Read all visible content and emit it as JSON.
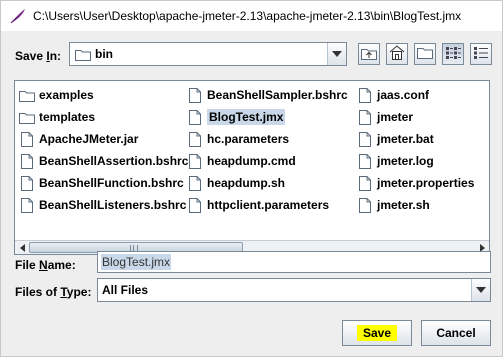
{
  "window": {
    "title": "C:\\Users\\User\\Desktop\\apache-jmeter-2.13\\apache-jmeter-2.13\\bin\\BlogTest.jmx",
    "app_icon": "feather-icon"
  },
  "save_in": {
    "label": "Save In:",
    "mnemonic_note": "I",
    "current_folder": "bin",
    "folder_icon": "folder-icon"
  },
  "toolbar": {
    "buttons": [
      {
        "name": "up-one-level",
        "icon": "folder-up-icon"
      },
      {
        "name": "home",
        "icon": "home-icon"
      },
      {
        "name": "new-folder",
        "icon": "new-folder-icon"
      },
      {
        "name": "list-view",
        "icon": "list-view-icon",
        "pressed": true
      },
      {
        "name": "details-view",
        "icon": "details-view-icon"
      }
    ]
  },
  "files": {
    "column1": [
      {
        "name": "examples",
        "type": "folder"
      },
      {
        "name": "templates",
        "type": "folder"
      },
      {
        "name": "ApacheJMeter.jar",
        "type": "file"
      },
      {
        "name": "BeanShellAssertion.bshrc",
        "type": "file"
      },
      {
        "name": "BeanShellFunction.bshrc",
        "type": "file"
      },
      {
        "name": "BeanShellListeners.bshrc",
        "type": "file"
      }
    ],
    "column2": [
      {
        "name": "BeanShellSampler.bshrc",
        "type": "file"
      },
      {
        "name": "BlogTest.jmx",
        "type": "file",
        "selected": true
      },
      {
        "name": "hc.parameters",
        "type": "file"
      },
      {
        "name": "heapdump.cmd",
        "type": "file"
      },
      {
        "name": "heapdump.sh",
        "type": "file"
      },
      {
        "name": "httpclient.parameters",
        "type": "file"
      }
    ],
    "column3": [
      {
        "name": "jaas.conf",
        "type": "file"
      },
      {
        "name": "jmeter",
        "type": "file"
      },
      {
        "name": "jmeter.bat",
        "type": "file"
      },
      {
        "name": "jmeter.log",
        "type": "file"
      },
      {
        "name": "jmeter.properties",
        "type": "file"
      },
      {
        "name": "jmeter.sh",
        "type": "file"
      }
    ]
  },
  "file_name": {
    "label": "File Name:",
    "value": "BlogTest.jmx"
  },
  "files_of_type": {
    "label": "Files of Type:",
    "value": "All Files"
  },
  "buttons": {
    "save": "Save",
    "cancel": "Cancel"
  },
  "colors": {
    "save_highlight": "#ffff00",
    "selection": "#c8d8e8",
    "title_icon": "#7b2a8c"
  }
}
